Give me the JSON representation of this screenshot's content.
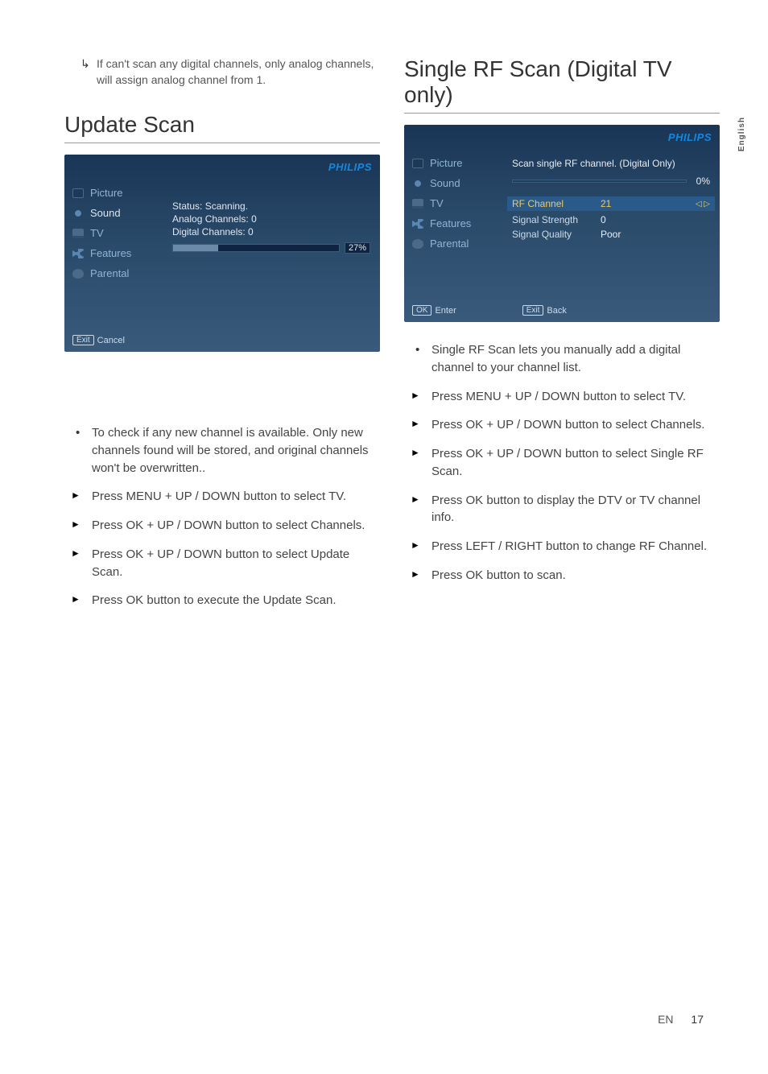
{
  "sideTab": "English",
  "footer": {
    "lang": "EN",
    "page": "17"
  },
  "colLeft": {
    "introNote": "If can't scan any digital channels, only analog channels, will assign analog channel from 1.",
    "heading": "Update Scan",
    "tvShot": {
      "brand": "PHILIPS",
      "sidebar": [
        "Picture",
        "Sound",
        "TV",
        "Features",
        "Parental"
      ],
      "status": "Status: Scanning.",
      "analog": "Analog Channels: 0",
      "digital": "Digital Channels: 0",
      "progressPct": 27,
      "progressLabel": "27%",
      "footer": {
        "key1": "Exit",
        "label1": "Cancel"
      }
    },
    "list": [
      {
        "type": "bullet",
        "text": "To check if any new channel is available. Only new channels found will be stored, and original channels won't be overwritten.."
      },
      {
        "type": "tri",
        "text": "Press MENU + UP / DOWN button to select TV."
      },
      {
        "type": "tri",
        "text": "Press OK + UP / DOWN button to select Channels."
      },
      {
        "type": "tri",
        "text": "Press OK + UP / DOWN button to select Update Scan."
      },
      {
        "type": "tri",
        "text": "Press OK button to execute the Update Scan."
      }
    ]
  },
  "colRight": {
    "heading": "Single RF Scan (Digital TV only)",
    "tvShot": {
      "brand": "PHILIPS",
      "sidebar": [
        "Picture",
        "Sound",
        "TV",
        "Features",
        "Parental"
      ],
      "heading": "Scan single RF channel. (Digital Only)",
      "pct": "0%",
      "rows": {
        "rf": {
          "label": "RF Channel",
          "value": "21",
          "arrows": "◁ ▷"
        },
        "strength": {
          "label": "Signal Strength",
          "value": "0"
        },
        "quality": {
          "label": "Signal Quality",
          "value": "Poor"
        }
      },
      "footer": {
        "key1": "OK",
        "label1": "Enter",
        "key2": "Exit",
        "label2": "Back"
      }
    },
    "list": [
      {
        "type": "bullet",
        "text": "Single RF Scan lets you manually add a digital channel to your channel list."
      },
      {
        "type": "tri",
        "text": "Press MENU + UP / DOWN button to select TV."
      },
      {
        "type": "tri",
        "text": "Press OK + UP / DOWN button to select Channels."
      },
      {
        "type": "tri",
        "text": "Press OK + UP / DOWN button to select Single RF Scan."
      },
      {
        "type": "tri",
        "text": "Press OK button to display the DTV or TV channel info."
      },
      {
        "type": "tri",
        "text": "Press LEFT / RIGHT button to change RF Channel."
      },
      {
        "type": "tri",
        "text": "Press OK button to scan."
      }
    ]
  }
}
